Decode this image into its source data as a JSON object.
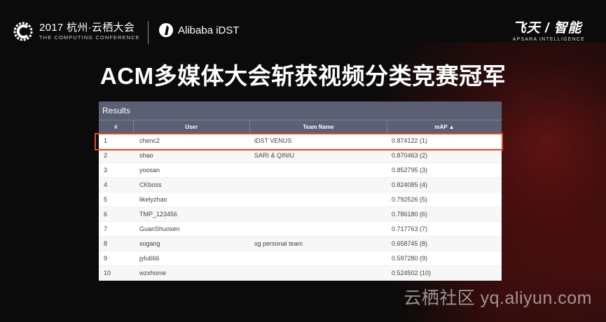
{
  "header": {
    "conference_title": "2017 杭州·云栖大会",
    "conference_subtitle": "THE COMPUTING CONFERENCE",
    "partner_name": "Alibaba iDST",
    "brand_main": "飞天 / 智能",
    "brand_sub": "APSARA INTELLIGENCE"
  },
  "headline": "ACM多媒体大会斩获视频分类竞赛冠军",
  "table": {
    "panel_title": "Results",
    "columns": {
      "rank": "#",
      "user": "User",
      "team": "Team Name",
      "map": "mAP ▲"
    },
    "rows": [
      {
        "rank": "1",
        "user": "chenc2",
        "team": "iDST VENUS",
        "map": "0.874122 (1)"
      },
      {
        "rank": "2",
        "user": "shao",
        "team": "SARI & QINIU",
        "map": "0.870463 (2)"
      },
      {
        "rank": "3",
        "user": "yoosan",
        "team": "",
        "map": "0.852795 (3)"
      },
      {
        "rank": "4",
        "user": "CKboss",
        "team": "",
        "map": "0.824085 (4)"
      },
      {
        "rank": "5",
        "user": "likelyzhao",
        "team": "",
        "map": "0.792526 (5)"
      },
      {
        "rank": "6",
        "user": "TMP_123456",
        "team": "",
        "map": "0.786180 (6)"
      },
      {
        "rank": "7",
        "user": "GuanShuosen",
        "team": "",
        "map": "0.717763 (7)"
      },
      {
        "rank": "8",
        "user": "sogang",
        "team": "sg personal team",
        "map": "0.658745 (8)"
      },
      {
        "rank": "9",
        "user": "jylu666",
        "team": "",
        "map": "0.597280 (9)"
      },
      {
        "rank": "10",
        "user": "wzxhome",
        "team": "",
        "map": "0.524502 (10)"
      }
    ]
  },
  "watermark": "云栖社区 yq.aliyun.com",
  "colors": {
    "highlight": "#e04a2b",
    "header_bg": "#5a5f73",
    "background": "#0b0b0b"
  },
  "icons": {
    "conference_logo": "computing-conference-logo-icon",
    "partner_logo": "idst-logo-icon"
  }
}
